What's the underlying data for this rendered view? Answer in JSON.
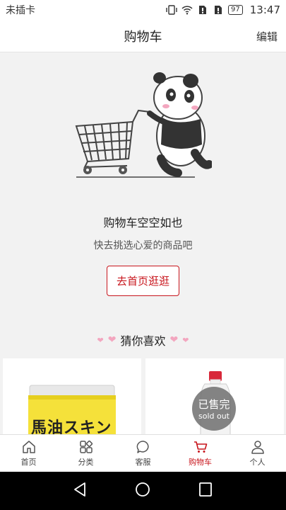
{
  "status_bar": {
    "carrier": "未插卡",
    "battery": "97",
    "time": "13:47"
  },
  "header": {
    "title": "购物车",
    "edit_label": "编辑"
  },
  "empty_cart": {
    "title": "购物车空空如也",
    "subtitle": "快去挑选心爱的商品吧",
    "button_label": "去首页逛逛"
  },
  "recommend": {
    "heading": "猜你喜欢"
  },
  "products": [
    {
      "label": "馬油スキン",
      "sold_out": false
    },
    {
      "label": "",
      "sold_out": true,
      "badge_cn": "已售完",
      "badge_en": "sold out"
    }
  ],
  "tabs": [
    {
      "label": "首页",
      "icon": "home-icon"
    },
    {
      "label": "分类",
      "icon": "category-icon"
    },
    {
      "label": "客服",
      "icon": "chat-icon"
    },
    {
      "label": "购物车",
      "icon": "cart-icon",
      "active": true
    },
    {
      "label": "个人",
      "icon": "person-icon"
    }
  ],
  "colors": {
    "accent": "#c8161d",
    "background": "#f2f2f2"
  }
}
